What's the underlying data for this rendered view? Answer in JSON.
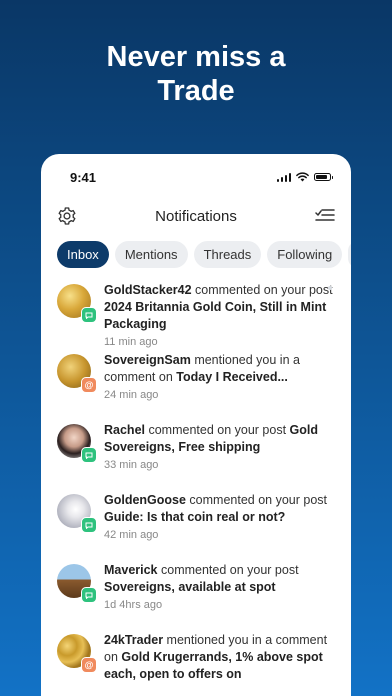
{
  "promo": {
    "headline_line1": "Never miss a",
    "headline_line2": "Trade"
  },
  "status_bar": {
    "time": "9:41"
  },
  "header": {
    "title": "Notifications"
  },
  "tabs": [
    {
      "label": "Inbox",
      "active": true
    },
    {
      "label": "Mentions",
      "active": false
    },
    {
      "label": "Threads",
      "active": false
    },
    {
      "label": "Following",
      "active": false
    }
  ],
  "notifications": [
    {
      "user": "GoldStacker42",
      "action": " commented on your post ",
      "subject": "2024 Britannia Gold Coin, Still in Mint Packaging",
      "time": "11 min ago",
      "type": "comment"
    },
    {
      "user": "SovereignSam",
      "action": " mentioned you in a comment on ",
      "subject": "Today I Received...",
      "time": "24 min ago",
      "type": "mention"
    },
    {
      "user": "Rachel",
      "action": " commented on your post ",
      "subject": "Gold Sovereigns, Free shipping",
      "time": "33 min ago",
      "type": "comment"
    },
    {
      "user": "GoldenGoose",
      "action": " commented on your post ",
      "subject": "Guide: Is that coin real or not?",
      "time": "42 min ago",
      "type": "comment"
    },
    {
      "user": "Maverick",
      "action": " commented on your post ",
      "subject": "Sovereigns, available at spot",
      "time": "1d 4hrs ago",
      "type": "comment"
    },
    {
      "user": "24kTrader",
      "action": " mentioned you in a comment on ",
      "subject": "Gold Krugerrands, 1% above spot each, open to offers on",
      "time": "",
      "type": "mention"
    }
  ],
  "colors": {
    "background_top": "#0a3766",
    "background_bottom": "#1272c6",
    "active_tab": "#0d3b6a",
    "comment_badge": "#2ec27e",
    "mention_badge": "#f08a5d"
  },
  "icons": {
    "settings": "gear-icon",
    "filter": "filter-list-icon",
    "comment_badge": "chat-bubble-icon",
    "mention_badge": "at-sign-icon"
  },
  "mention_symbol": "@"
}
